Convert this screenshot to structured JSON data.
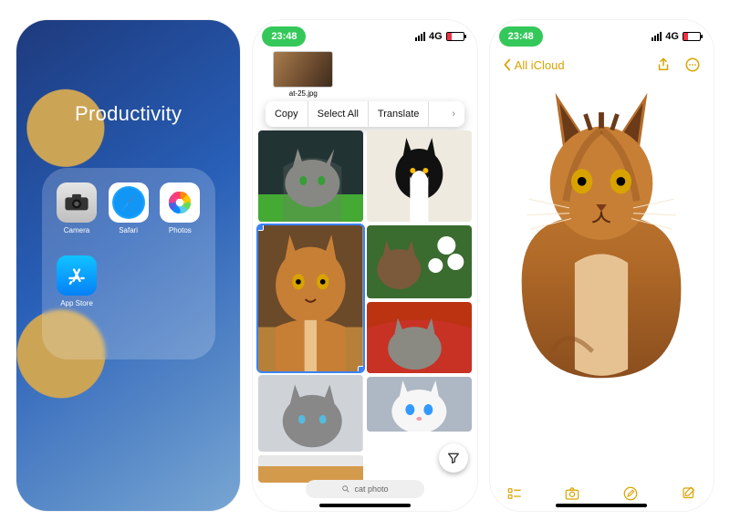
{
  "screen1": {
    "folder_title": "Productivity",
    "apps": [
      {
        "id": "camera",
        "label": "Camera"
      },
      {
        "id": "safari",
        "label": "Safari"
      },
      {
        "id": "photos",
        "label": "Photos"
      },
      {
        "id": "appstore",
        "label": "App Store"
      }
    ]
  },
  "screen2": {
    "status": {
      "time": "23:48",
      "network": "4G"
    },
    "filename": "at-25.jpg",
    "context_menu": {
      "copy": "Copy",
      "select_all": "Select All",
      "translate": "Translate",
      "more": "›"
    },
    "tiles": [
      "grey-tabby-indoors",
      "black-white-tuxedo",
      "orange-tabby-sitting",
      "brown-tabby-flowers",
      "grey-tabby-red-blanket",
      "grey-cat-closeup",
      "white-cat-blue-eyes",
      "orange-cat-partial"
    ],
    "search": {
      "placeholder": "cat photo",
      "icon": "magnifier"
    },
    "filter_icon": "funnel"
  },
  "screen3": {
    "status": {
      "time": "23:48",
      "network": "4G"
    },
    "nav": {
      "back_label": "All iCloud",
      "share_icon": "share",
      "more_icon": "ellipsis-circle"
    },
    "pasted_subject": "orange-tabby-cutout",
    "toolbar": {
      "checklist": "checklist",
      "camera": "camera",
      "draw": "pencil-circle",
      "compose": "compose"
    }
  },
  "colors": {
    "notes_tint": "#d9a300",
    "time_pill": "#34c85a",
    "selection": "#3a82f7"
  }
}
